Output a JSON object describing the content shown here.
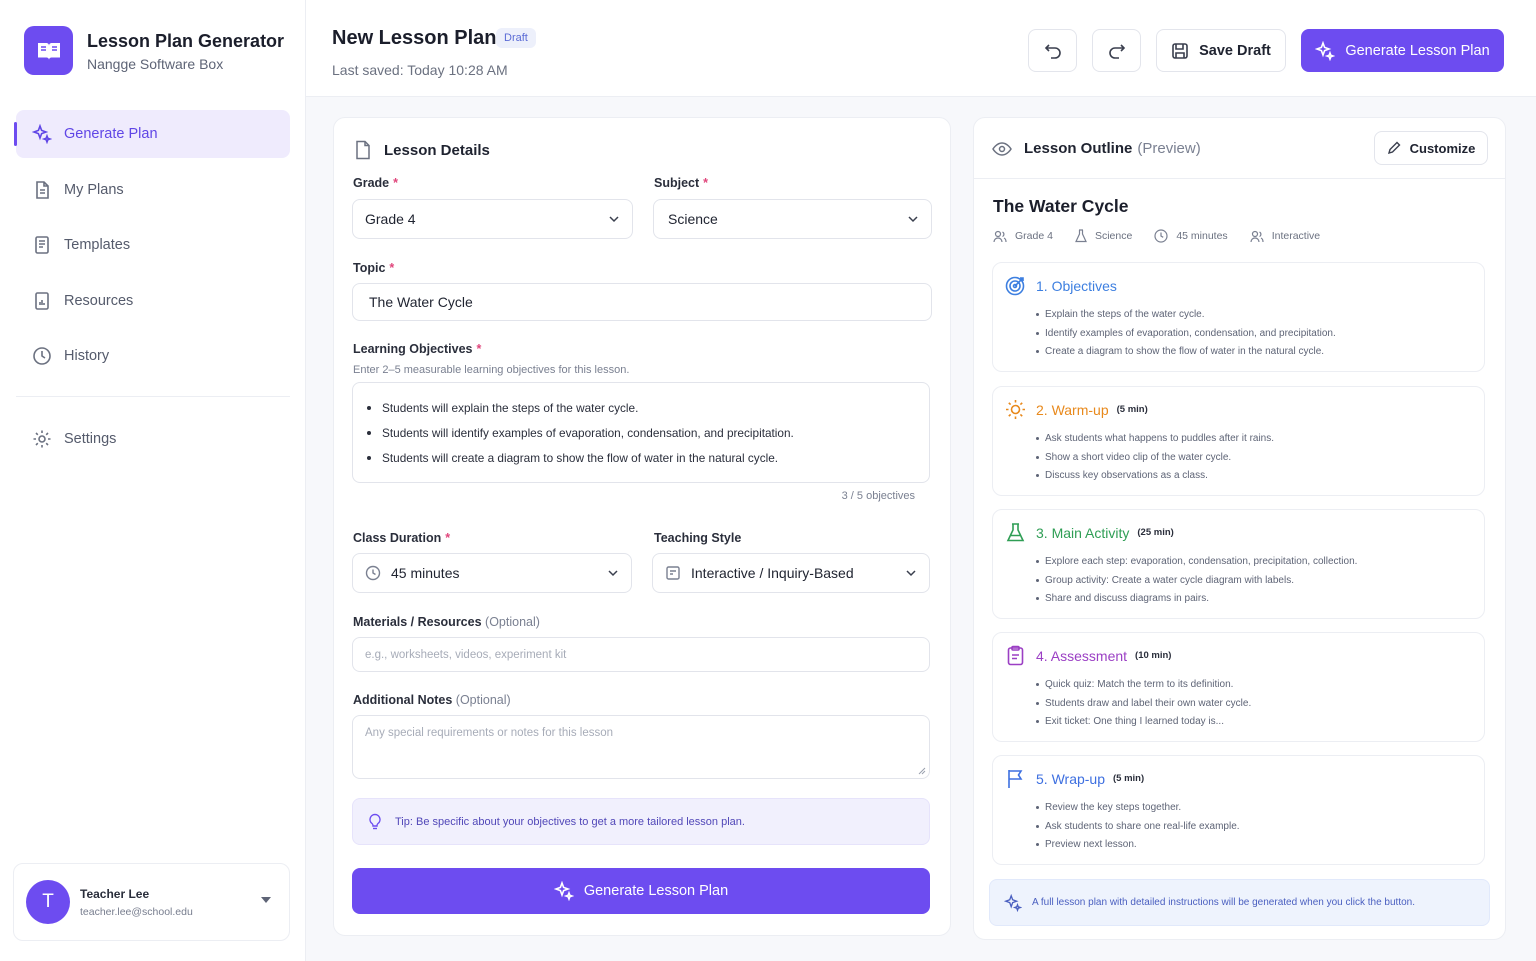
{
  "app": {
    "title": "Lesson Plan Generator",
    "subtitle": "Nangge Software Box"
  },
  "sidebar": {
    "items": [
      {
        "label": "Generate Plan",
        "icon": "sparkle-icon",
        "active": true
      },
      {
        "label": "My Plans",
        "icon": "document-icon"
      },
      {
        "label": "Templates",
        "icon": "template-icon"
      },
      {
        "label": "Resources",
        "icon": "resources-icon"
      },
      {
        "label": "History",
        "icon": "clock-icon"
      }
    ],
    "settings_label": "Settings",
    "user": {
      "initial": "T",
      "name": "Teacher Lee",
      "email": "teacher.lee@school.edu"
    }
  },
  "header": {
    "title": "New Lesson Plan",
    "badge": "Draft",
    "last_saved": "Last saved: Today 10:28 AM",
    "save_label": "Save Draft",
    "generate_label": "Generate Lesson Plan"
  },
  "form": {
    "title": "Lesson Details",
    "grade": {
      "label": "Grade",
      "value": "Grade 4"
    },
    "subject": {
      "label": "Subject",
      "value": "Science"
    },
    "topic": {
      "label": "Topic",
      "value": "The Water Cycle"
    },
    "objectives": {
      "label": "Learning Objectives",
      "help": "Enter 2–5 measurable learning objectives for this lesson.",
      "items": [
        "Students will explain the steps of the water cycle.",
        "Students will identify examples of evaporation, condensation, and precipitation.",
        "Students will create a diagram to show the flow of water in the natural cycle."
      ],
      "count": "3 / 5 objectives"
    },
    "duration": {
      "label": "Class Duration",
      "value": "45 minutes"
    },
    "style": {
      "label": "Teaching Style",
      "value": "Interactive / Inquiry-Based"
    },
    "materials": {
      "label": "Materials / Resources",
      "optional": "(Optional)",
      "placeholder": "e.g., worksheets, videos, experiment kit"
    },
    "notes": {
      "label": "Additional Notes",
      "optional": "(Optional)",
      "placeholder": "Any special requirements or notes for this lesson"
    },
    "tip": "Tip: Be specific about your objectives to get a more tailored lesson plan.",
    "generate_label": "Generate Lesson Plan"
  },
  "preview": {
    "title": "Lesson Outline",
    "title_suffix": "(Preview)",
    "customize_label": "Customize",
    "lesson_title": "The Water Cycle",
    "meta": [
      "Grade 4",
      "Science",
      "45 minutes",
      "Interactive"
    ],
    "sections": [
      {
        "name": "1. Objectives",
        "duration": "",
        "color": "#3d7fe0",
        "icon": "target-icon",
        "items": [
          "Explain the steps of the water cycle.",
          "Identify examples of evaporation, condensation, and precipitation.",
          "Create a diagram to show the flow of water in the natural cycle."
        ]
      },
      {
        "name": "2. Warm-up",
        "duration": "(5 min)",
        "color": "#e8891c",
        "icon": "sun-icon",
        "items": [
          "Ask students what happens to puddles after it rains.",
          "Show a short video clip of the water cycle.",
          "Discuss key observations as a class."
        ]
      },
      {
        "name": "3. Main Activity",
        "duration": "(25 min)",
        "color": "#2f9e55",
        "icon": "flask-icon",
        "items": [
          "Explore each step: evaporation, condensation, precipitation, collection.",
          "Group activity: Create a water cycle diagram with labels.",
          "Share and discuss diagrams in pairs."
        ]
      },
      {
        "name": "4. Assessment",
        "duration": "(10 min)",
        "color": "#9b3fc4",
        "icon": "clipboard-icon",
        "items": [
          "Quick quiz: Match the term to its definition.",
          "Students draw and label their own water cycle.",
          "Exit ticket: One thing I learned today is..."
        ]
      },
      {
        "name": "5. Wrap-up",
        "duration": "(5 min)",
        "color": "#3d6fe0",
        "icon": "flag-icon",
        "items": [
          "Review the key steps together.",
          "Ask students to share one real-life example.",
          "Preview next lesson."
        ]
      }
    ],
    "footer": "A full lesson plan with detailed instructions will be generated when you click the button."
  },
  "colors": {
    "accent": "#6d4cf0"
  }
}
